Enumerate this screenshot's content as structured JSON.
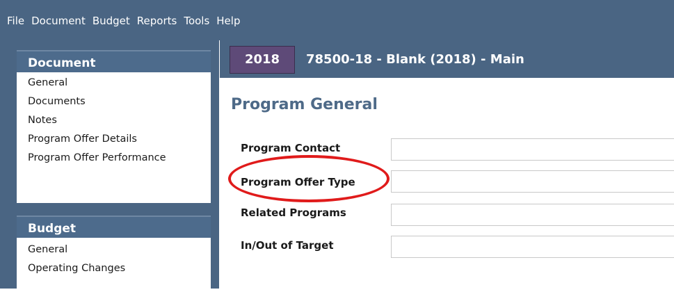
{
  "menu": {
    "items": [
      "File",
      "Document",
      "Budget",
      "Reports",
      "Tools",
      "Help"
    ]
  },
  "sidebar": {
    "document": {
      "header": "Document",
      "items": [
        "General",
        "Documents",
        "Notes",
        "Program Offer Details",
        "Program Offer Performance"
      ]
    },
    "budget": {
      "header": "Budget",
      "items": [
        "General",
        "Operating Changes"
      ]
    }
  },
  "header": {
    "year": "2018",
    "title": "78500-18 - Blank (2018) - Main"
  },
  "main": {
    "page_title": "Program General",
    "fields": [
      {
        "label": "Program Contact",
        "value": ""
      },
      {
        "label": "Program Offer Type",
        "value": ""
      },
      {
        "label": "Related Programs",
        "value": ""
      },
      {
        "label": "In/Out of Target",
        "value": ""
      }
    ]
  },
  "colors": {
    "frame": "#4a6583",
    "year_box": "#5e4a78",
    "page_title": "#4e6a88",
    "highlight": "#e01b1b"
  }
}
